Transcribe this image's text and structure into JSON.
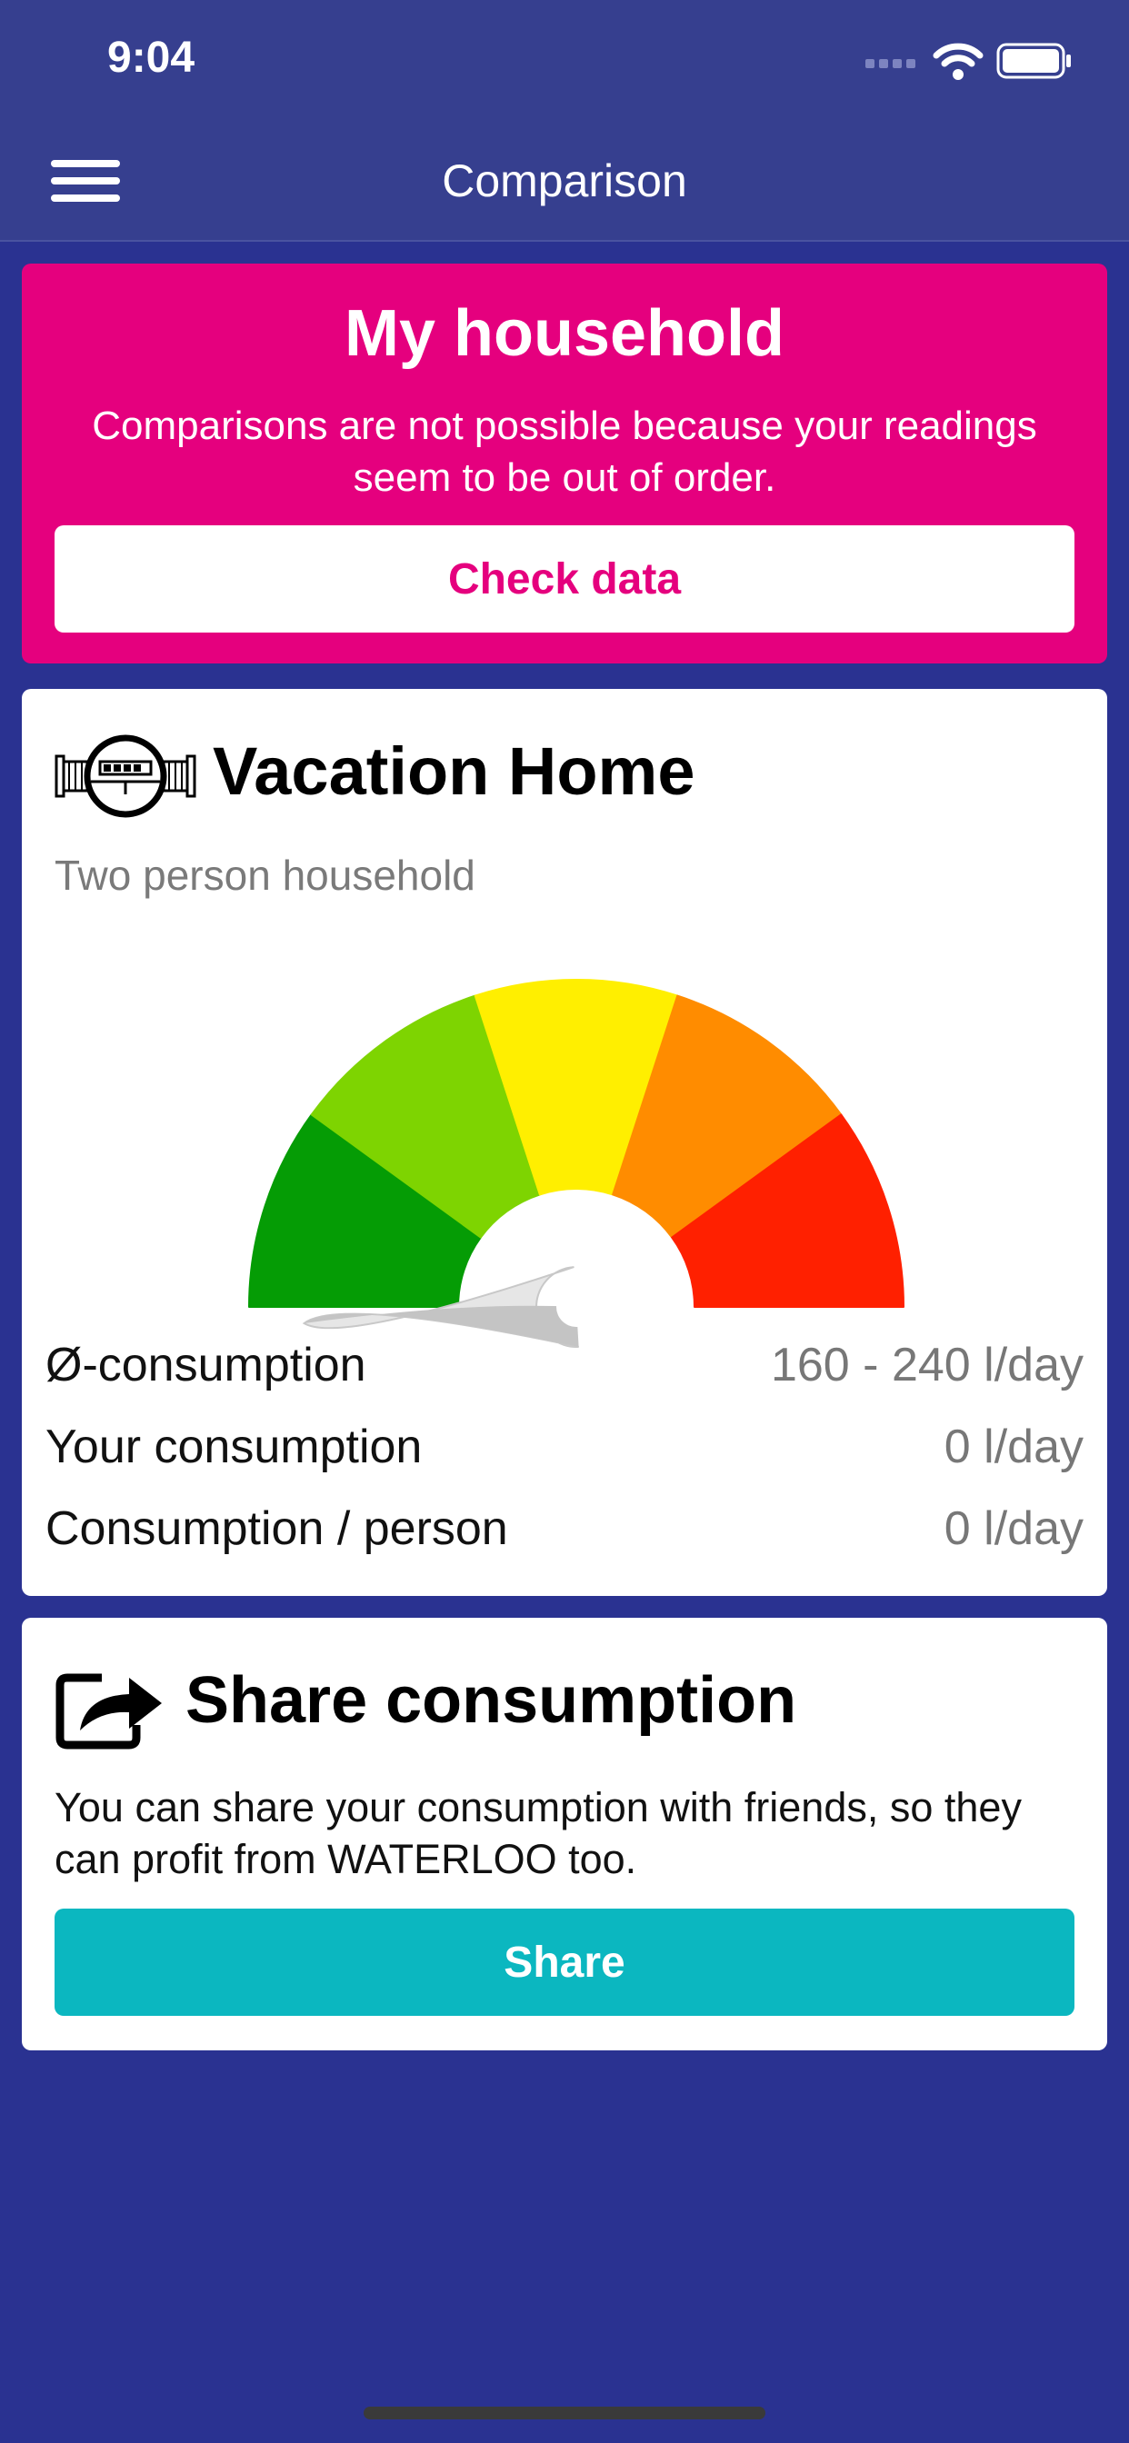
{
  "status_bar": {
    "time": "9:04"
  },
  "nav": {
    "title": "Comparison",
    "menu_icon": "hamburger-menu-icon"
  },
  "household_card": {
    "title": "My household",
    "message": "Comparisons are not possible because your readings seem to be out of order.",
    "button_label": "Check data",
    "color": "#e5007e"
  },
  "vacation_card": {
    "icon": "water-meter-icon",
    "title": "Vacation Home",
    "subtitle": "Two person household",
    "gauge": {
      "segment_colors": [
        "#059c05",
        "#7ed401",
        "#ffef00",
        "#ff8c00",
        "#ff2000"
      ],
      "needle_level": 0
    },
    "rows": [
      {
        "label": "Ø-consumption",
        "value": "160 - 240 l/day"
      },
      {
        "label": "Your consumption",
        "value": "0 l/day"
      },
      {
        "label": "Consumption / person",
        "value": "0 l/day"
      }
    ]
  },
  "share_card": {
    "icon": "share-icon",
    "title": "Share consumption",
    "text": "You can share your consumption with friends, so they can profit from WATERLOO too.",
    "button_label": "Share",
    "button_color": "#0bb7c0"
  }
}
